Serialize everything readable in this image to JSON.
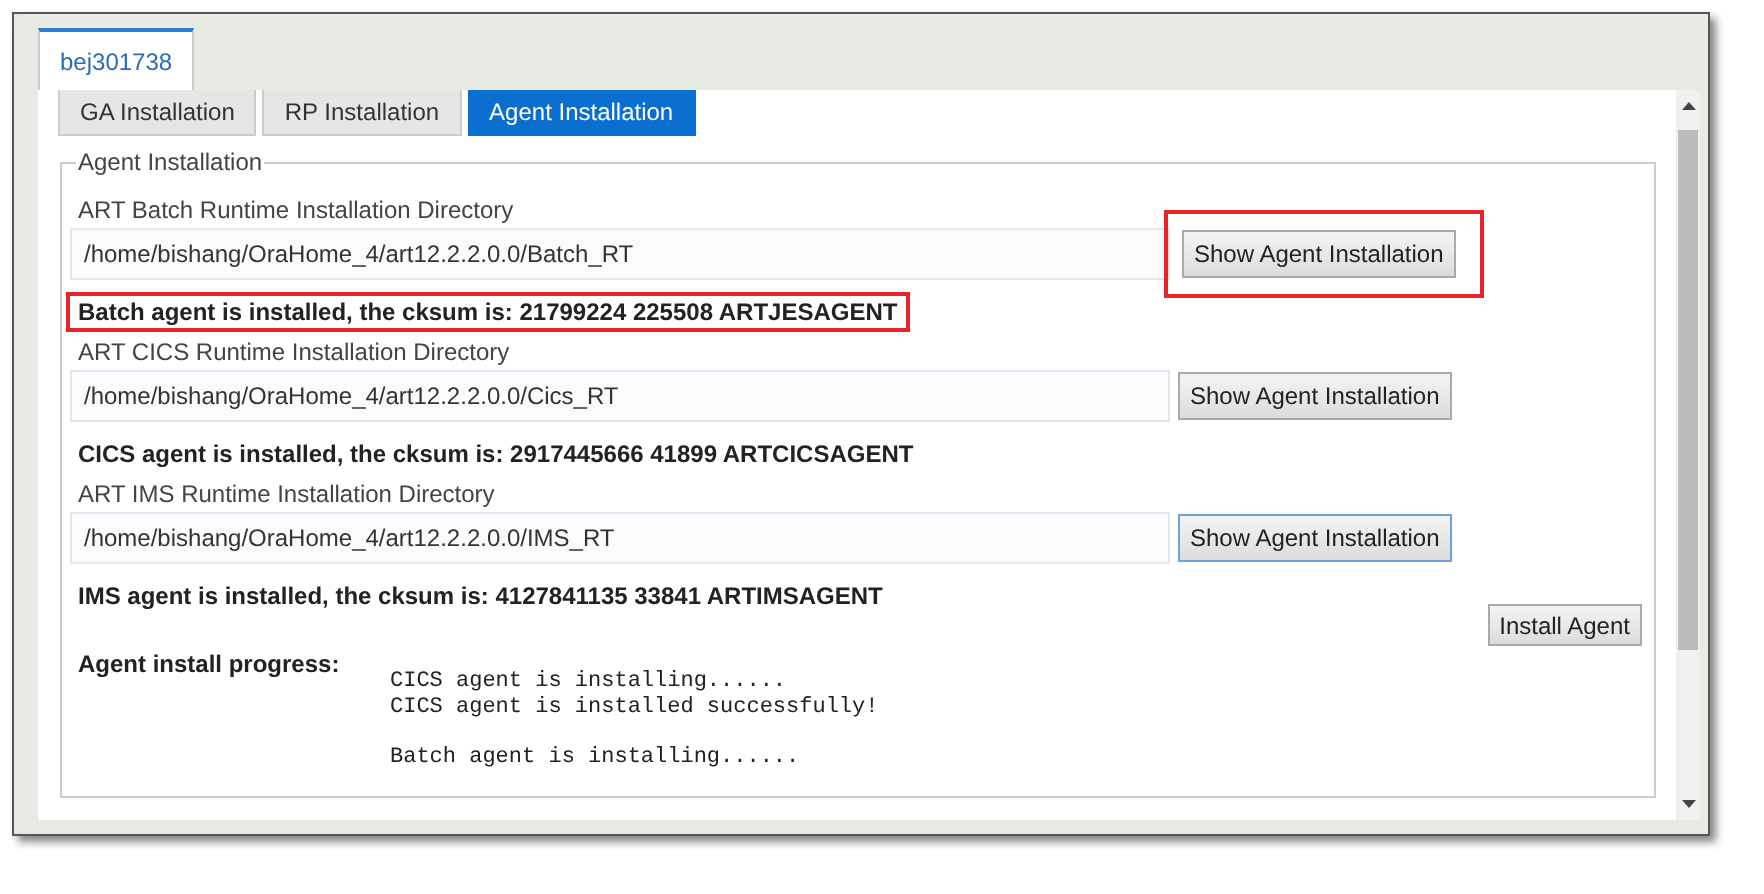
{
  "tabs": [
    {
      "label": "bej301738",
      "selected": true
    }
  ],
  "subtabs": [
    {
      "label": "GA Installation",
      "selected": false
    },
    {
      "label": "RP Installation",
      "selected": false
    },
    {
      "label": "Agent Installation",
      "selected": true
    }
  ],
  "section": {
    "legend": "Agent Installation",
    "agents": [
      {
        "label": "ART Batch Runtime Installation Directory",
        "path": "/home/bishang/OraHome_4/art12.2.2.0.0/Batch_RT",
        "button": "Show Agent Installation",
        "focused": false,
        "highlighted": true,
        "status": "Batch agent is installed, the cksum is: 21799224 225508 ARTJESAGENT"
      },
      {
        "label": "ART CICS Runtime Installation Directory",
        "path": "/home/bishang/OraHome_4/art12.2.2.0.0/Cics_RT",
        "button": "Show Agent Installation",
        "focused": false,
        "highlighted": false,
        "status": "CICS agent is installed, the cksum is: 2917445666 41899 ARTCICSAGENT"
      },
      {
        "label": "ART IMS Runtime Installation Directory",
        "path": "/home/bishang/OraHome_4/art12.2.2.0.0/IMS_RT",
        "button": "Show Agent Installation",
        "focused": true,
        "highlighted": false,
        "status": "IMS agent is installed, the cksum is: 4127841135 33841 ARTIMSAGENT"
      }
    ]
  },
  "install_button": "Install Agent",
  "progress": {
    "label": "Agent install progress:",
    "log": [
      [
        "CICS agent is installing......",
        "CICS agent is installed successfully!"
      ],
      [
        "Batch agent is installing......"
      ]
    ]
  }
}
